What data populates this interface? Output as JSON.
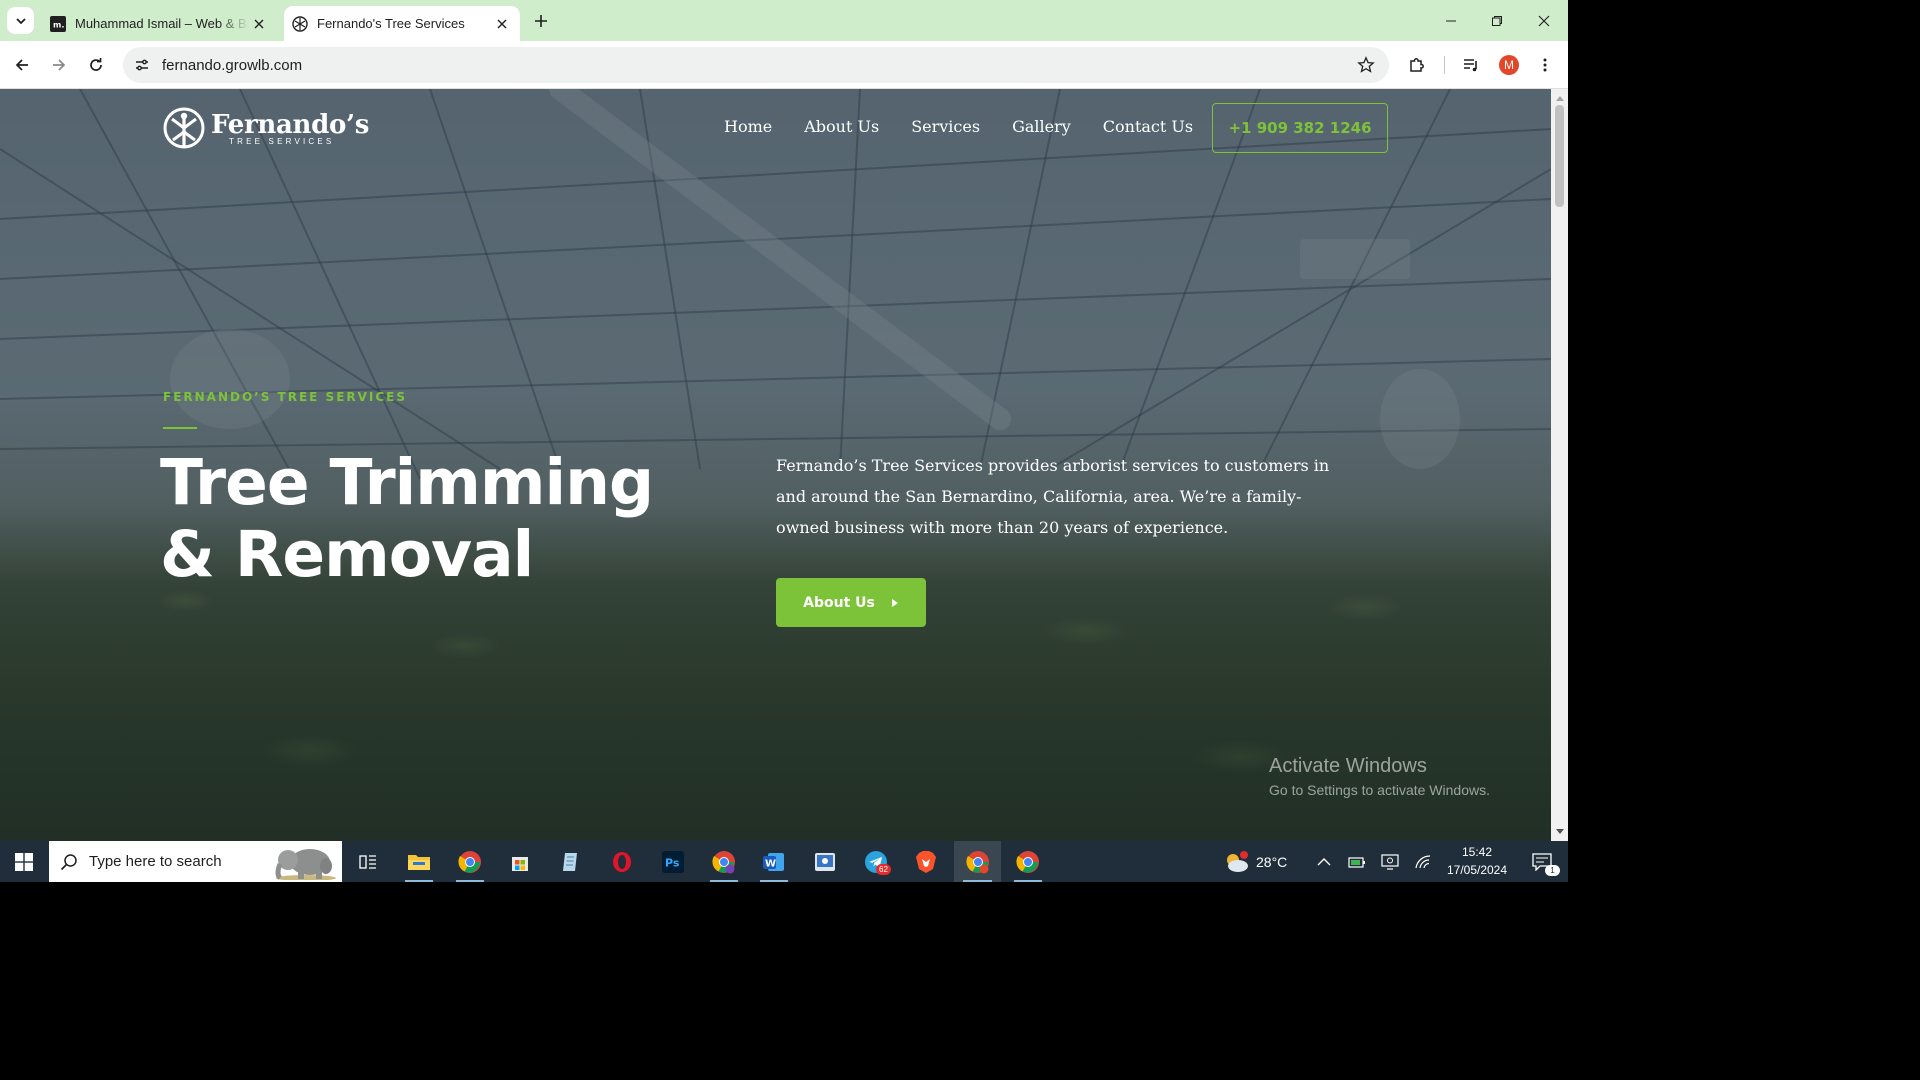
{
  "browser": {
    "tabs": [
      {
        "title": "Muhammad Ismail – Web & Brand",
        "active": false
      },
      {
        "title": "Fernando's Tree Services",
        "active": true
      }
    ],
    "url": "fernando.growlb.com",
    "profile_initial": "M"
  },
  "site": {
    "logo": {
      "name": "Fernando’s",
      "tagline": "TREE SERVICES"
    },
    "nav": [
      "Home",
      "About Us",
      "Services",
      "Gallery",
      "Contact Us"
    ],
    "phone": "+1 909 382 1246",
    "hero": {
      "eyebrow": "FERNANDO’S TREE SERVICES",
      "title_line1": "Tree Trimming",
      "title_line2": "& Removal",
      "description": "Fernando’s Tree Services provides arborist services to customers in and around the San Bernardino, California, area. We’re a family-owned business with more than 20 years of experience.",
      "cta_label": "About Us"
    },
    "colors": {
      "accent": "#7dc339",
      "overlay": "#16232f"
    }
  },
  "windows_watermark": {
    "line1": "Activate Windows",
    "line2": "Go to Settings to activate Windows."
  },
  "taskbar": {
    "search_placeholder": "Type here to search",
    "apps": [
      "task-view",
      "file-explorer",
      "chrome",
      "microsoft-store",
      "notepad",
      "opera",
      "photoshop",
      "chrome-profile",
      "word",
      "app",
      "telegram",
      "brave",
      "chrome-m",
      "chrome-alt"
    ],
    "telegram_badge": "62",
    "temperature": "28°C",
    "time": "15:42",
    "date": "17/05/2024",
    "notification_count": "1"
  }
}
